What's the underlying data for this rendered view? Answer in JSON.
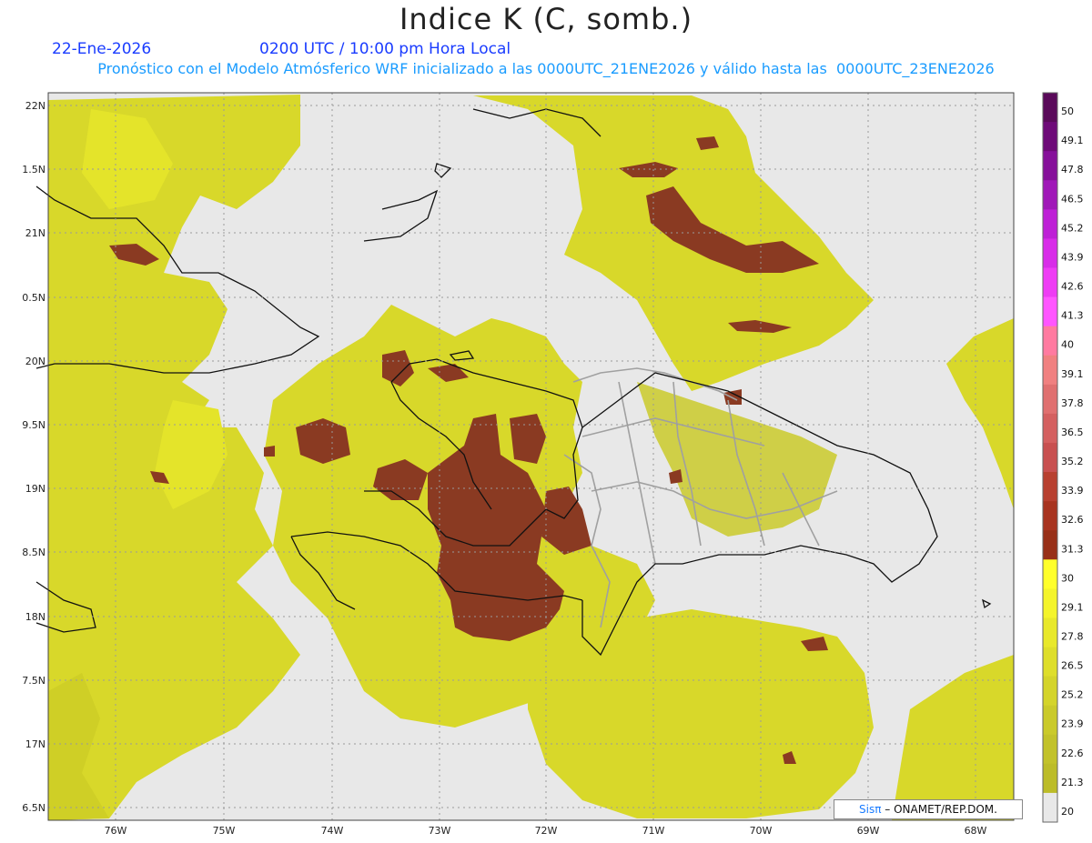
{
  "header": {
    "title": "Indice K (C, somb.)",
    "date": "22-Ene-2026",
    "time": "0200 UTC / 10:00 pm Hora Local",
    "forecast": "Pronóstico con el Modelo Atmósferico WRF inicializado a las 0000UTC_21ENE2026 y válido hasta las  0000UTC_23ENE2026"
  },
  "axes": {
    "lat_labels": [
      "22N",
      "1.5N",
      "21N",
      "0.5N",
      "20N",
      "9.5N",
      "19N",
      "8.5N",
      "18N",
      "7.5N",
      "17N",
      "6.5N"
    ],
    "lon_labels": [
      "76W",
      "75W",
      "74W",
      "73W",
      "72W",
      "71W",
      "70W",
      "69W",
      "68W"
    ]
  },
  "colorbar": {
    "labels": [
      "50",
      "49.1",
      "47.8",
      "46.5",
      "45.2",
      "43.9",
      "42.6",
      "41.3",
      "40",
      "39.1",
      "37.8",
      "36.5",
      "35.2",
      "33.9",
      "32.6",
      "31.3",
      "30",
      "29.1",
      "27.8",
      "26.5",
      "25.2",
      "23.9",
      "22.6",
      "21.3",
      "20"
    ],
    "colors": [
      "#5a0a5a",
      "#6e0a78",
      "#86109a",
      "#a018b8",
      "#be20d6",
      "#d82ce8",
      "#ee3cf4",
      "#ff55ff",
      "#ff7aa0",
      "#f08080",
      "#e07070",
      "#d46060",
      "#c85050",
      "#b84030",
      "#a83420",
      "#983018",
      "#ffff2a",
      "#f4f42a",
      "#e8e82a",
      "#dede2a",
      "#d4d42a",
      "#caca2a",
      "#c2c22a",
      "#bcbc28",
      "#e8e8e8"
    ]
  },
  "credit": {
    "logo": "Sisπ",
    "text": "– ONAMET/REP.DOM."
  },
  "colors": {
    "background": "#e8e8e8",
    "yellow": "#dede2a",
    "brown": "#8a3a22",
    "coast": "#111111",
    "border": "#a0a0a0"
  }
}
